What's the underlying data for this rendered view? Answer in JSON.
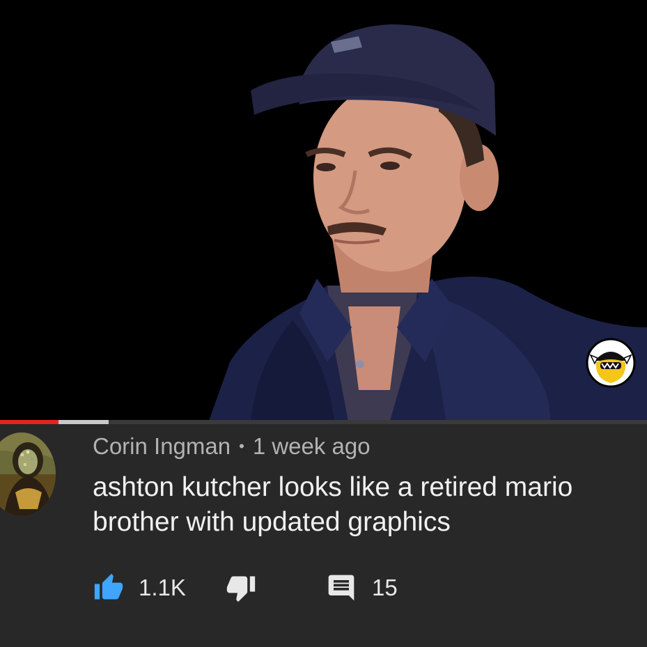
{
  "video": {
    "progress_played_fraction": 0.09,
    "progress_buffered_fraction": 0.168,
    "badge_icon": "hot-ones-channel-logo"
  },
  "comment": {
    "author": "Corin Ingman",
    "separator": "•",
    "timestamp": "1 week ago",
    "text": "ashton kutcher looks like a retired mario brother with updated graphics",
    "avatar_icon": "mona-lisa-avatar",
    "likes": "1.1K",
    "replies": "15",
    "like_icon": "thumbs-up-icon",
    "dislike_icon": "thumbs-down-icon",
    "reply_icon": "comment-icon"
  },
  "colors": {
    "background": "#282828",
    "progress_red": "#e52420",
    "like_blue": "#3ea6ff",
    "meta_text": "#b3b3b3",
    "body_text": "#f1f1f1"
  }
}
